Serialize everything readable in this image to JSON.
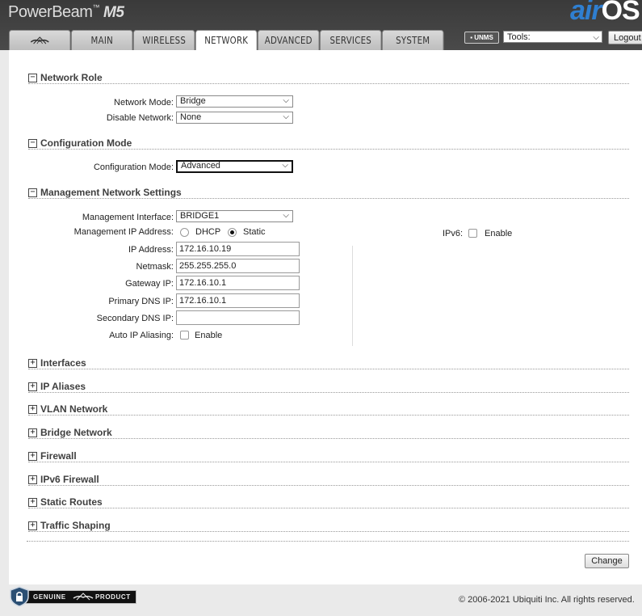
{
  "header": {
    "brand": "PowerBeam",
    "brand_tm": "™",
    "model": "M5",
    "logo_air": "air",
    "logo_os": "OS",
    "tabs": [
      {
        "label": "",
        "icon": "ubiquiti-logo-icon"
      },
      {
        "label": "MAIN"
      },
      {
        "label": "WIRELESS"
      },
      {
        "label": "NETWORK",
        "active": true
      },
      {
        "label": "ADVANCED"
      },
      {
        "label": "SERVICES"
      },
      {
        "label": "SYSTEM"
      }
    ],
    "unms_label": "UNMS",
    "tools_value": "Tools:",
    "logout_label": "Logout"
  },
  "sections": {
    "network_role": {
      "title": "Network Role",
      "toggle": "−"
    },
    "config_mode": {
      "title": "Configuration Mode",
      "toggle": "−"
    },
    "mgmt": {
      "title": "Management Network Settings",
      "toggle": "−"
    },
    "collapsed": [
      {
        "title": "Interfaces",
        "toggle": "+"
      },
      {
        "title": "IP Aliases",
        "toggle": "+"
      },
      {
        "title": "VLAN Network",
        "toggle": "+"
      },
      {
        "title": "Bridge Network",
        "toggle": "+"
      },
      {
        "title": "Firewall",
        "toggle": "+"
      },
      {
        "title": "IPv6 Firewall",
        "toggle": "+"
      },
      {
        "title": "Static Routes",
        "toggle": "+"
      },
      {
        "title": "Traffic Shaping",
        "toggle": "+"
      }
    ]
  },
  "network_role": {
    "network_mode_label": "Network Mode:",
    "network_mode_value": "Bridge",
    "disable_network_label": "Disable Network:",
    "disable_network_value": "None"
  },
  "config_mode": {
    "label": "Configuration Mode:",
    "value": "Advanced"
  },
  "mgmt": {
    "interface_label": "Management Interface:",
    "interface_value": "BRIDGE1",
    "ip_addr_label": "Management IP Address:",
    "dhcp_label": "DHCP",
    "static_label": "Static",
    "selected": "Static",
    "ip_label": "IP Address:",
    "ip_value": "172.16.10.19",
    "netmask_label": "Netmask:",
    "netmask_value": "255.255.255.0",
    "gateway_label": "Gateway IP:",
    "gateway_value": "172.16.10.1",
    "dns1_label": "Primary DNS IP:",
    "dns1_value": "172.16.10.1",
    "dns2_label": "Secondary DNS IP:",
    "dns2_value": "",
    "alias_label": "Auto IP Aliasing:",
    "alias_enable": "Enable",
    "ipv6_label": "IPv6:",
    "ipv6_enable": "Enable"
  },
  "change_label": "Change",
  "footer": {
    "genuine_left": "GENUINE",
    "genuine_right": "PRODUCT",
    "copyright": "© 2006-2021 Ubiquiti Inc. All rights reserved."
  }
}
